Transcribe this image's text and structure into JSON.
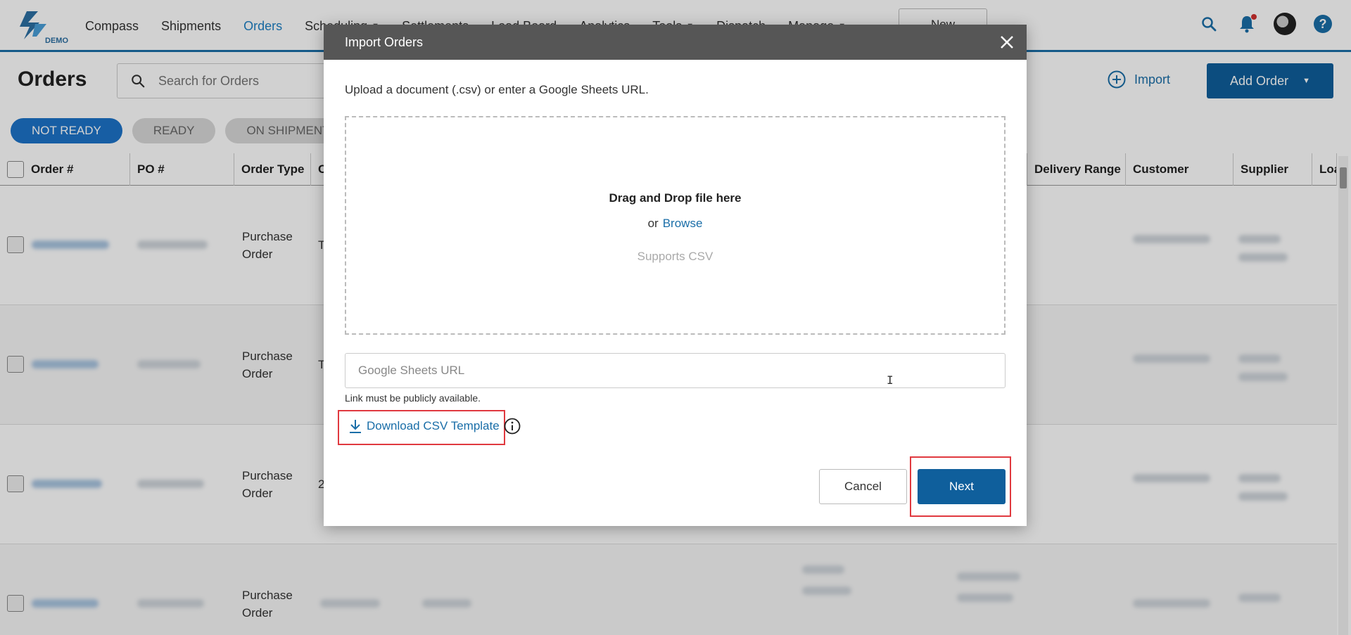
{
  "nav": {
    "logo_text": "DEMO",
    "items": [
      {
        "label": "Compass",
        "active": false,
        "caret": false
      },
      {
        "label": "Shipments",
        "active": false,
        "caret": false
      },
      {
        "label": "Orders",
        "active": true,
        "caret": false
      },
      {
        "label": "Scheduling",
        "active": false,
        "caret": true
      },
      {
        "label": "Settlements",
        "active": false,
        "caret": false
      },
      {
        "label": "Load Board",
        "active": false,
        "caret": false
      },
      {
        "label": "Analytics",
        "active": false,
        "caret": false
      },
      {
        "label": "Tools",
        "active": false,
        "caret": true
      },
      {
        "label": "Dispatch",
        "active": false,
        "caret": false
      },
      {
        "label": "Manage",
        "active": false,
        "caret": true
      }
    ],
    "new_button": "New"
  },
  "page": {
    "title": "Orders",
    "search_placeholder": "Search for Orders",
    "import_label": "Import",
    "add_order_label": "Add Order"
  },
  "tabs": [
    {
      "label": "NOT READY",
      "active": true
    },
    {
      "label": "READY",
      "active": false
    },
    {
      "label": "ON SHIPMENTS",
      "active": false
    }
  ],
  "table": {
    "columns": [
      "Order #",
      "PO #",
      "Order Type",
      "C",
      "Delivery Range",
      "Customer",
      "Supplier",
      "Loa"
    ],
    "rows": [
      {
        "order_type": "Purchase Order",
        "col_c": "T"
      },
      {
        "order_type": "Purchase Order",
        "col_c": "T"
      },
      {
        "order_type": "Purchase Order",
        "col_c": "2"
      },
      {
        "order_type": "Purchase Order",
        "col_c": ""
      }
    ]
  },
  "modal": {
    "title": "Import Orders",
    "description": "Upload a document (.csv) or enter a Google Sheets URL.",
    "drop_title": "Drag and Drop file here",
    "drop_or": "or",
    "drop_browse": "Browse",
    "drop_supports": "Supports CSV",
    "url_placeholder": "Google Sheets URL",
    "url_value": "",
    "url_note": "Link must be publicly available.",
    "download_label": "Download CSV Template",
    "cancel_label": "Cancel",
    "next_label": "Next"
  },
  "colors": {
    "brand": "#0f5f9c",
    "link": "#1a6ea8",
    "tab_active": "#1d73c9",
    "modal_header": "#565656",
    "highlight": "#e0393f"
  }
}
